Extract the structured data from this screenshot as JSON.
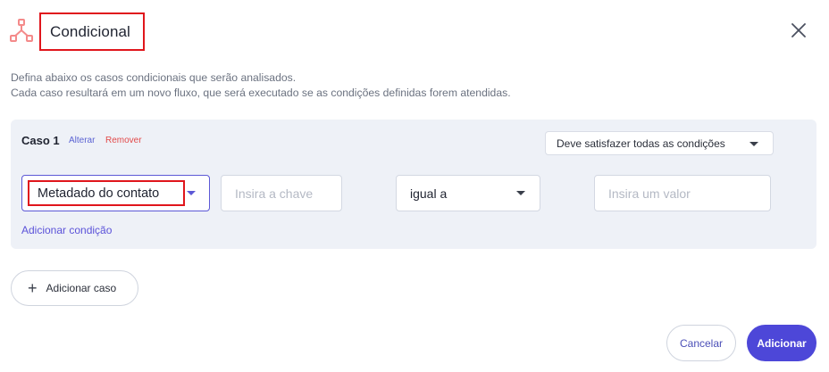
{
  "header": {
    "title": "Condicional",
    "icon": "branch-icon",
    "close_icon": "close-icon",
    "accent_color": "#f48a8a"
  },
  "description": {
    "line1": "Defina abaixo os casos condicionais que serão analisados.",
    "line2": "Cada caso resultará em um novo fluxo, que será executado se as condições definidas forem atendidas."
  },
  "case": {
    "title": "Caso 1",
    "alter_label": "Alterar",
    "remove_label": "Remover",
    "match_mode": "Deve satisfazer todas as condições",
    "condition": {
      "source_value": "Metadado do contato",
      "key_placeholder": "Insira a chave",
      "operator_value": "igual a",
      "value_placeholder": "Insira um valor"
    },
    "add_condition_label": "Adicionar condição"
  },
  "actions": {
    "add_case_label": "Adicionar caso",
    "cancel_label": "Cancelar",
    "submit_label": "Adicionar",
    "primary_color": "#4d47d8"
  }
}
